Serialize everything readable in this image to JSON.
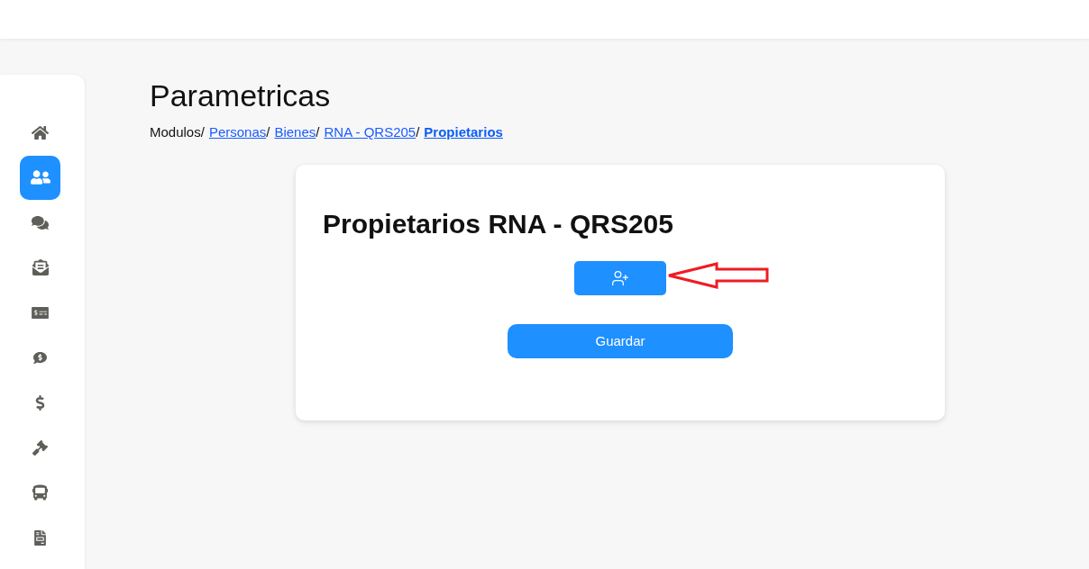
{
  "sidebar": {
    "items": [
      {
        "selected": false
      },
      {
        "selected": true
      },
      {
        "selected": false
      },
      {
        "selected": false
      },
      {
        "selected": false
      },
      {
        "selected": false
      },
      {
        "selected": false
      },
      {
        "selected": false
      },
      {
        "selected": false
      },
      {
        "selected": false
      }
    ]
  },
  "page": {
    "title": "Parametricas",
    "breadcrumb": [
      {
        "kind": "text",
        "label": "Modulos",
        "separator": "/"
      },
      {
        "kind": "link",
        "label": "Personas",
        "separator": "/"
      },
      {
        "kind": "link",
        "label": "Bienes",
        "separator": "/"
      },
      {
        "kind": "link",
        "label": "RNA - QRS205",
        "separator": "/"
      },
      {
        "kind": "current",
        "label": "Propietarios"
      }
    ]
  },
  "card": {
    "title": "Propietarios RNA - QRS205",
    "buttons": [
      {
        "kind": "add_person"
      },
      {
        "kind": "save",
        "label": "Guardar"
      }
    ]
  }
}
